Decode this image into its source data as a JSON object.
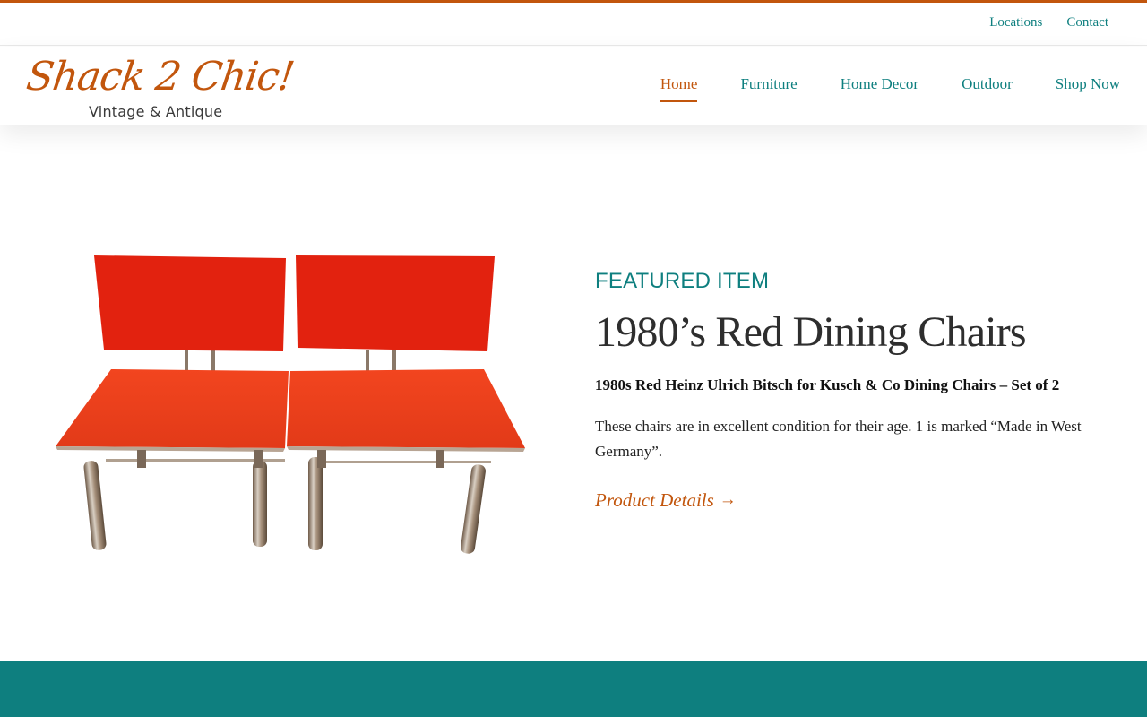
{
  "colors": {
    "accent_orange": "#c2560d",
    "teal": "#0e7f7f",
    "footer_band": "#0e7f7f"
  },
  "topbar": {
    "links": [
      "Locations",
      "Contact"
    ]
  },
  "logo": {
    "script_text": "Shack 2 Chic!",
    "sub_text": "Vintage & Antique"
  },
  "nav": {
    "items": [
      {
        "label": "Home",
        "active": true
      },
      {
        "label": "Furniture"
      },
      {
        "label": "Home Decor"
      },
      {
        "label": "Outdoor"
      },
      {
        "label": "Shop Now"
      }
    ]
  },
  "featured": {
    "eyebrow": "FEATURED ITEM",
    "title": "1980’s Red Dining Chairs",
    "subtitle": "1980s Red Heinz Ulrich Bitsch for Kusch & Co Dining Chairs – Set of 2",
    "description": "These chairs are in excellent condition for their age. 1 is marked “Made in West Germany”.",
    "link_label": "Product Details",
    "link_arrow": "→"
  }
}
